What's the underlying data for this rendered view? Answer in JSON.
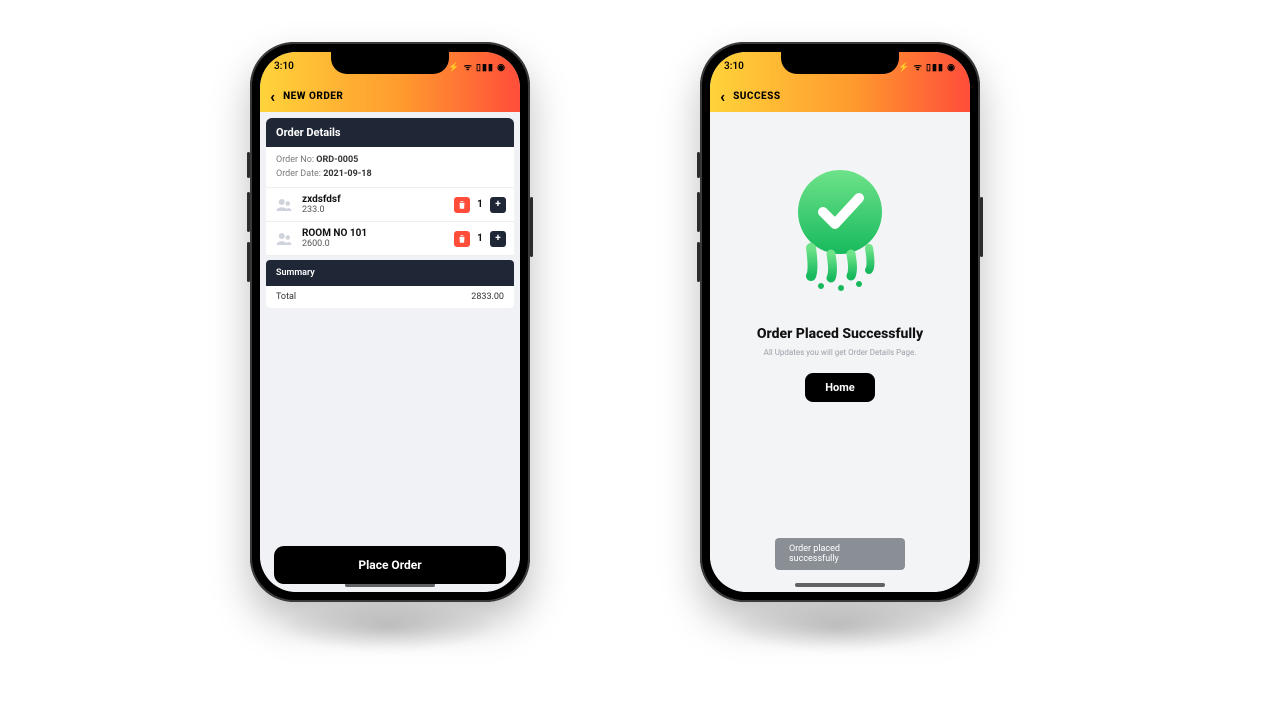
{
  "status_time": "3:10",
  "status_icons": "⚡ ᯤ ▯▮▮ ◉",
  "screen_left": {
    "appbar_title": "NEW ORDER",
    "order_details_header": "Order Details",
    "order_no_label": "Order No:",
    "order_no_value": "ORD-0005",
    "order_date_label": "Order Date:",
    "order_date_value": "2021-09-18",
    "items": [
      {
        "name": "zxdsfdsf",
        "price": "233.0",
        "qty": "1"
      },
      {
        "name": "ROOM NO 101",
        "price": "2600.0",
        "qty": "1"
      }
    ],
    "summary_label": "Summary",
    "total_label": "Total",
    "total_value": "2833.00",
    "place_order_label": "Place Order"
  },
  "screen_right": {
    "appbar_title": "SUCCESS",
    "success_title": "Order Placed Successfully",
    "success_subtitle": "All Updates you will get Order Details Page.",
    "home_label": "Home",
    "toast": "Order placed successfully"
  }
}
